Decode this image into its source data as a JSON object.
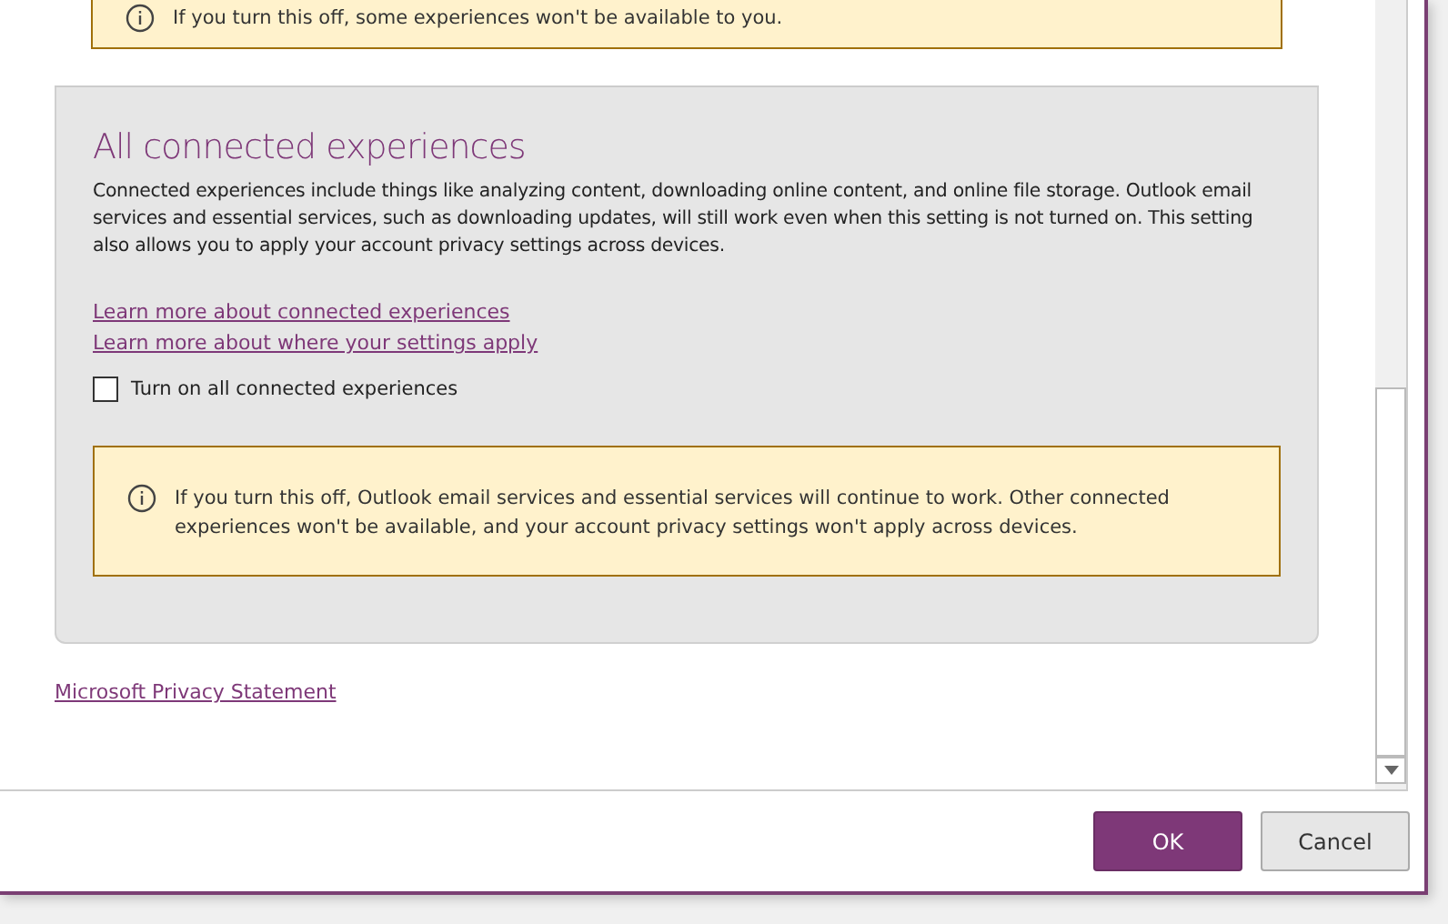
{
  "top_notice": {
    "text": "If you turn this off, some experiences won't be available to you."
  },
  "section": {
    "title": "All connected experiences",
    "description": "Connected experiences include things like analyzing content, downloading online content, and online file storage. Outlook email services and essential services, such as downloading updates, will still work even when this setting is not turned on. This setting also allows you to apply your account privacy settings across devices.",
    "links": [
      "Learn more about connected experiences",
      "Learn more about where your settings apply"
    ],
    "checkbox": {
      "label": "Turn on all connected experiences",
      "checked": false
    },
    "notice": {
      "text": "If you turn this off, Outlook email services and essential services will continue to work. Other connected experiences won't be available, and your account privacy settings won't apply across devices."
    }
  },
  "privacy_link": "Microsoft Privacy Statement",
  "buttons": [
    {
      "label": "OK",
      "kind": "primary"
    },
    {
      "label": "Cancel",
      "kind": "secondary"
    }
  ]
}
